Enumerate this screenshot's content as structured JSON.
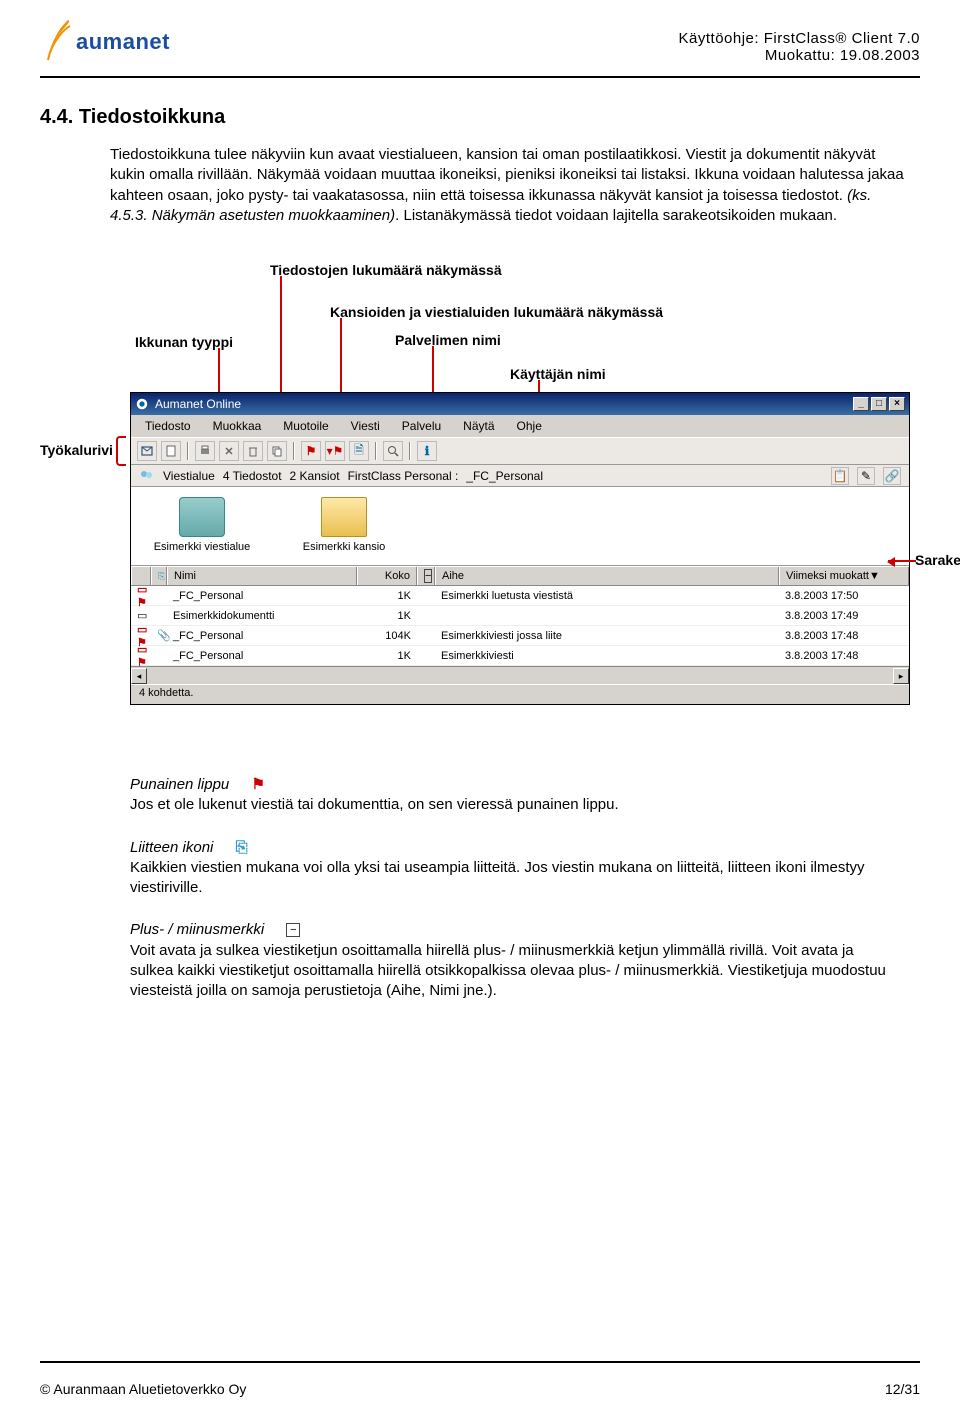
{
  "header": {
    "brand": "aumanet",
    "doc_title": "Käyttöohje: FirstClass® Client 7.0",
    "modified": "Muokattu: 19.08.2003"
  },
  "section": {
    "number_title": "4.4. Tiedostoikkuna",
    "body": "Tiedostoikkuna tulee näkyviin kun avaat viestialueen, kansion tai oman postilaatikkosi. Viestit ja dokumentit näkyvät kukin omalla rivillään. Näkymää voidaan muuttaa ikoneiksi, pieniksi ikoneiksi tai listaksi. Ikkuna voidaan halutessa jakaa kahteen osaan, joko pysty- tai vaakatasossa, niin että toisessa ikkunassa näkyvät kansiot ja toisessa tiedostot. ",
    "body_italic": "(ks. 4.5.3. Näkymän asetusten muokkaaminen)",
    "body_tail": ". Listanäkymässä tiedot voidaan lajitella sarakeotsikoiden mukaan."
  },
  "labels": {
    "ikkunan_tyyppi": "Ikkunan tyyppi",
    "tiedostojen": "Tiedostojen lukumäärä näkymässä",
    "kansioiden": "Kansioiden ja viestialuiden lukumäärä näkymässä",
    "palvelimen": "Palvelimen nimi",
    "kayttajan": "Käyttäjän nimi",
    "tyokalurivi": "Työkalurivi",
    "sarakeotsikko": "Sarakeotsikko"
  },
  "window": {
    "title": "Aumanet Online",
    "menus": [
      "Tiedosto",
      "Muokkaa",
      "Muotoile",
      "Viesti",
      "Palvelu",
      "Näytä",
      "Ohje"
    ],
    "statusline": {
      "area": "Viestialue",
      "files": "4 Tiedostot",
      "folders": "2 Kansiot",
      "server": "FirstClass Personal :",
      "user": "_FC_Personal"
    },
    "icons": [
      {
        "label": "Esimerkki viestialue",
        "kind": "area"
      },
      {
        "label": "Esimerkki kansio",
        "kind": "folder"
      }
    ],
    "columns": {
      "name": "Nimi",
      "size": "Koko",
      "subject": "Aihe",
      "date": "Viimeksi muokatt"
    },
    "rows": [
      {
        "flag": "⚑",
        "att": "",
        "name": "_FC_Personal",
        "size": "1K",
        "subject": "Esimerkki luetusta viestistä",
        "date": "3.8.2003 17:50"
      },
      {
        "flag": "",
        "att": "",
        "name": "Esimerkkidokumentti",
        "size": "1K",
        "subject": "",
        "date": "3.8.2003 17:49"
      },
      {
        "flag": "⚑",
        "att": "📎",
        "name": "_FC_Personal",
        "size": "104K",
        "subject": "Esimerkkiviesti jossa liite",
        "date": "3.8.2003 17:48"
      },
      {
        "flag": "⚑",
        "att": "",
        "name": "_FC_Personal",
        "size": "1K",
        "subject": "Esimerkkiviesti",
        "date": "3.8.2003 17:48"
      }
    ],
    "status": "4 kohdetta."
  },
  "legend": {
    "flag_title": "Punainen lippu",
    "flag_body": "Jos et ole lukenut viestiä tai dokumenttia, on sen vieressä punainen lippu.",
    "att_title": "Liitteen ikoni",
    "att_body": "Kaikkien viestien mukana voi olla yksi tai useampia liitteitä. Jos viestin mukana on liitteitä, liitteen ikoni ilmestyy viestiriville.",
    "pm_title": "Plus- / miinusmerkki",
    "pm_body": "Voit avata ja sulkea viestiketjun osoittamalla hiirellä plus- / miinusmerkkiä ketjun ylimmällä rivillä. Voit avata ja sulkea kaikki viestiketjut osoittamalla hiirellä otsikkopalkissa olevaa plus- / miinusmerkkiä. Viestiketjuja muodostuu viesteistä joilla on samoja perustietoja (Aihe, Nimi jne.)."
  },
  "footer": {
    "left": "© Auranmaan Aluetietoverkko Oy",
    "right": "12/31"
  }
}
